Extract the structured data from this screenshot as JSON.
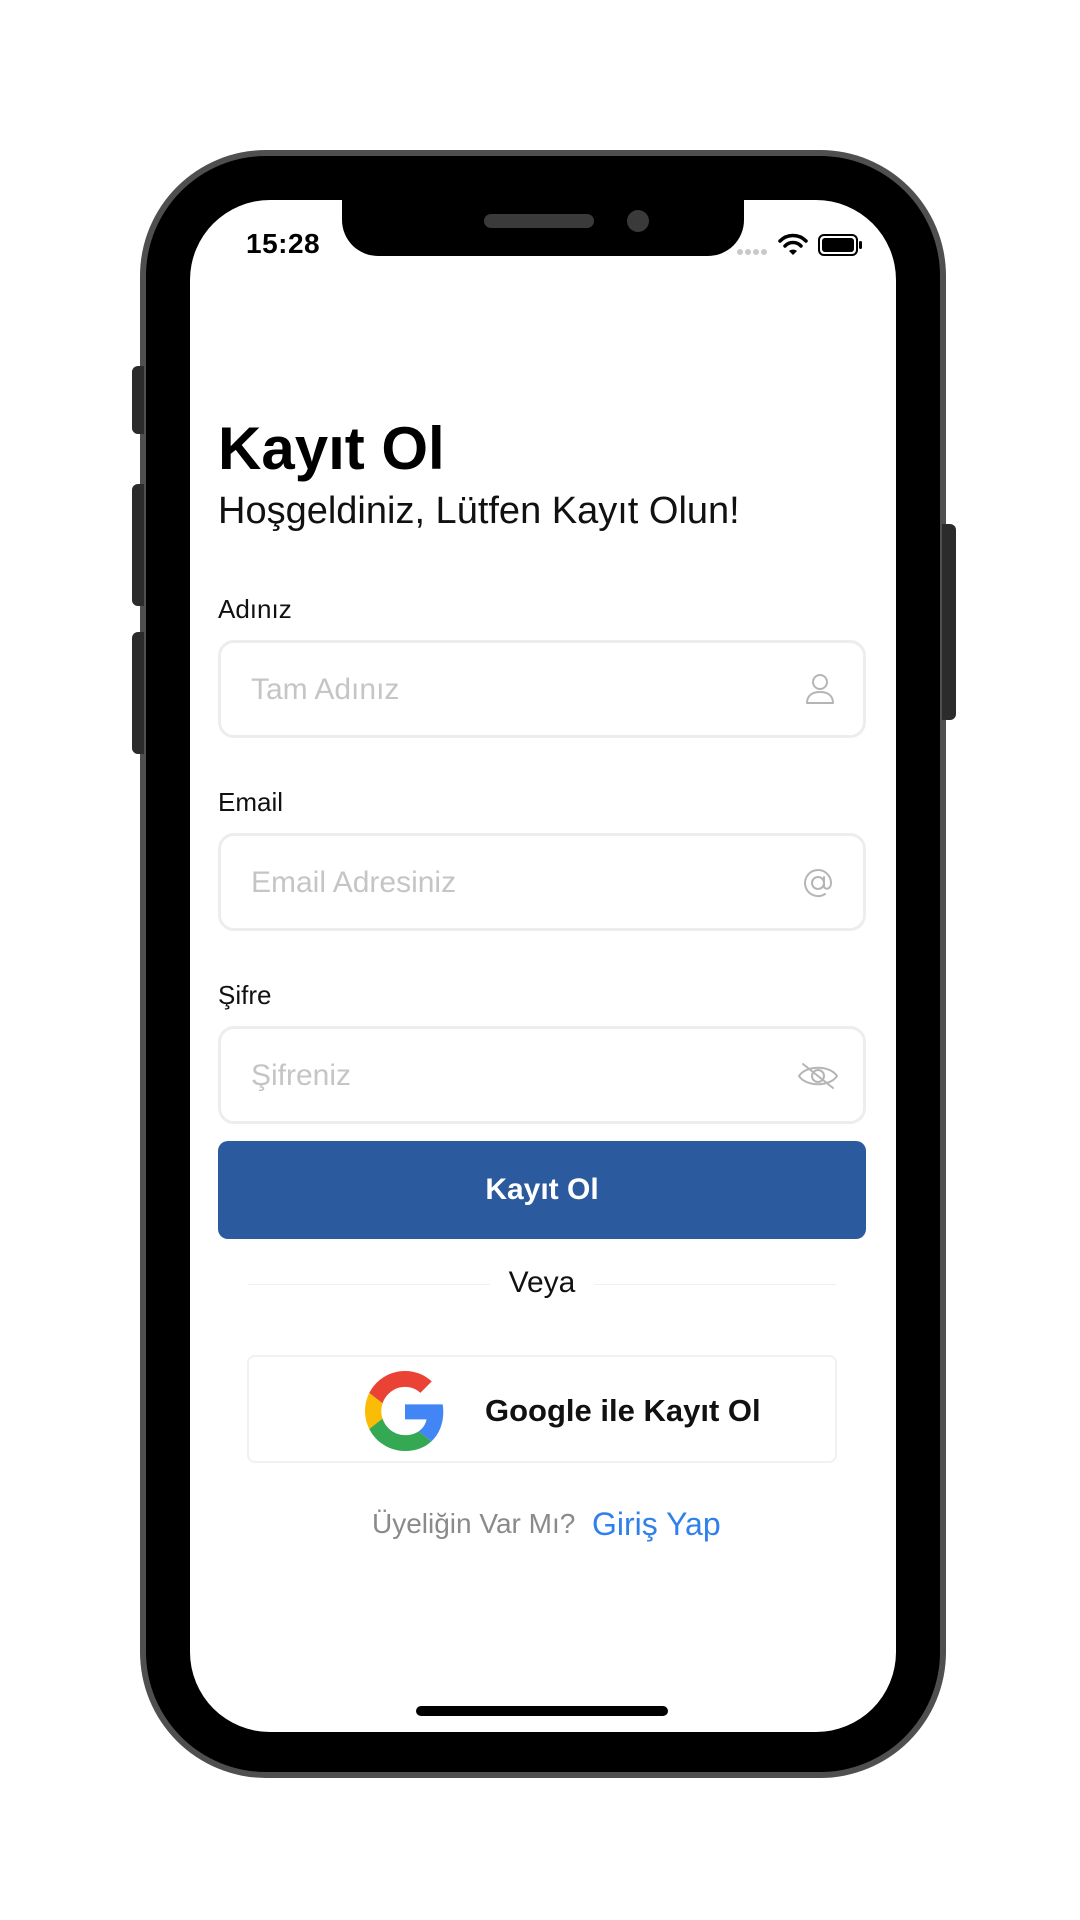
{
  "status_bar": {
    "time": "15:28"
  },
  "page": {
    "title": "Kayıt Ol",
    "subtitle": "Hoşgeldiniz, Lütfen Kayıt Olun!"
  },
  "form": {
    "name_label": "Adınız",
    "name_placeholder": "Tam Adınız",
    "name_icon": "user-icon",
    "email_label": "Email",
    "email_placeholder": "Email Adresiniz",
    "email_icon": "at-icon",
    "password_label": "Şifre",
    "password_placeholder": "Şifreniz",
    "password_icon": "eye-off-icon",
    "submit_label": "Kayıt Ol"
  },
  "divider": {
    "text": "Veya"
  },
  "google": {
    "label": "Google ile Kayıt Ol",
    "icon": "google-icon"
  },
  "footer": {
    "question": "Üyeliğin Var Mı?",
    "link": "Giriş Yap"
  },
  "colors": {
    "primary": "#2b5a9e",
    "link": "#2f80ed",
    "placeholder": "#c5c5c5",
    "field_border": "#ededed"
  }
}
